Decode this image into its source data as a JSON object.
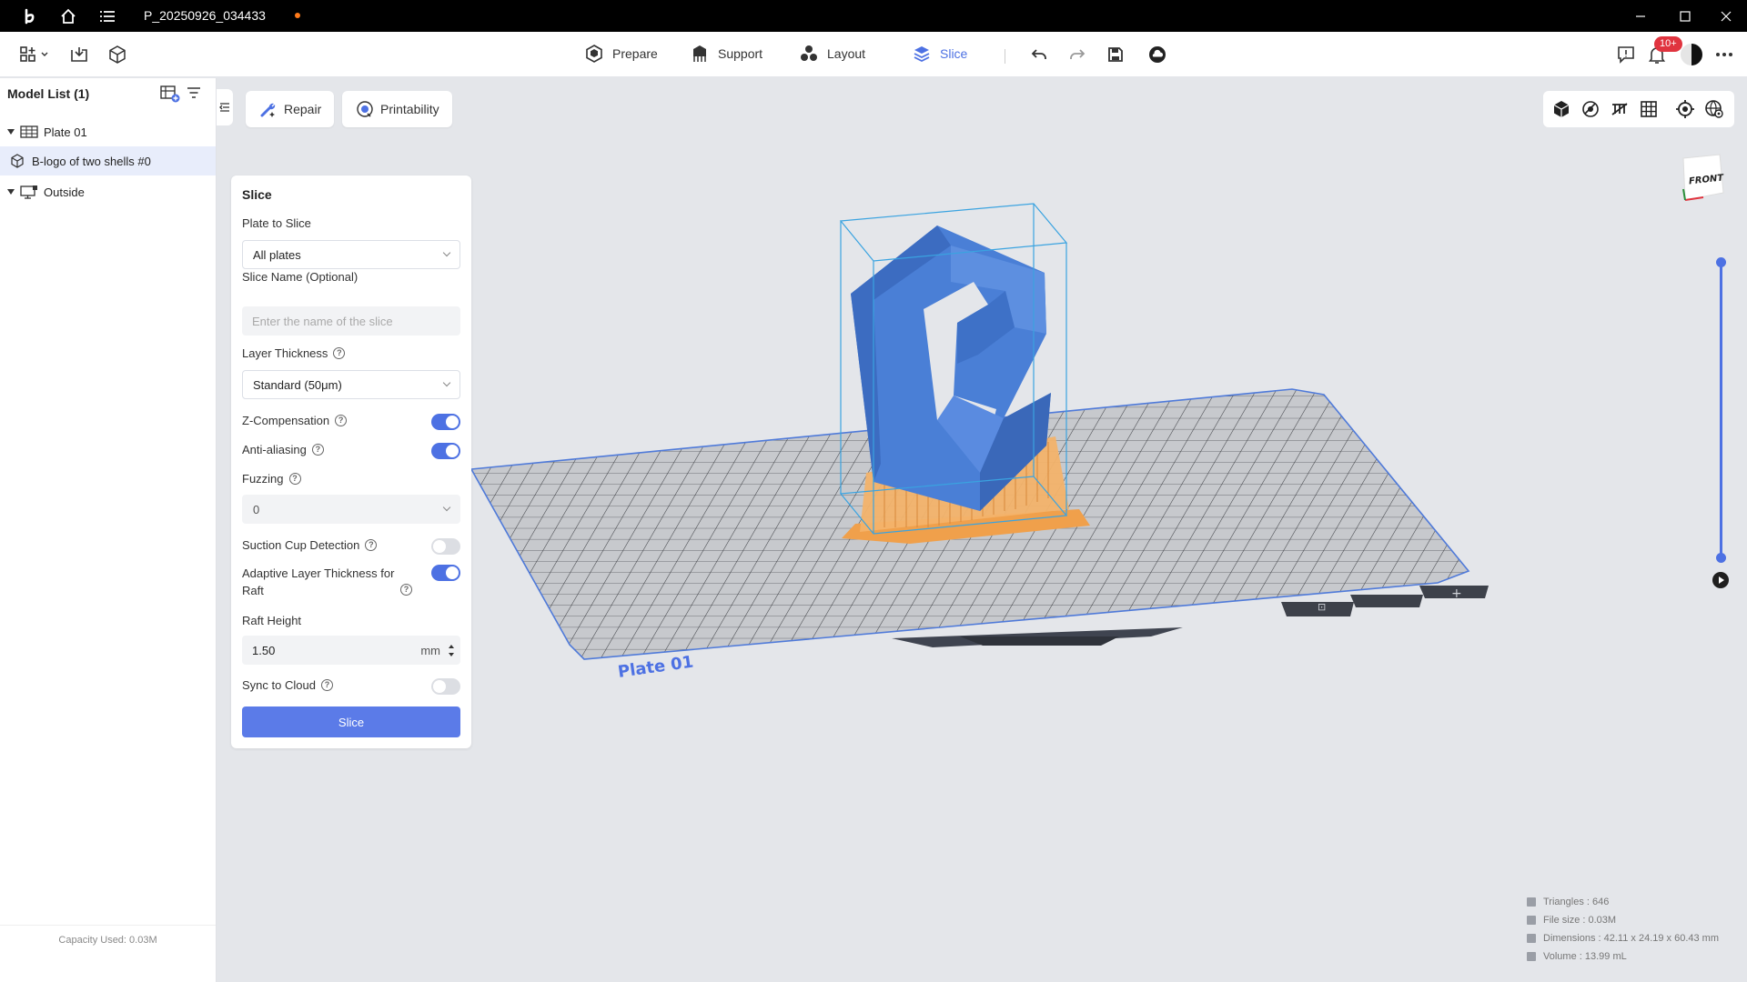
{
  "titlebar": {
    "project_name": "P_20250926_034433"
  },
  "nav": {
    "tabs": [
      {
        "label": "Prepare"
      },
      {
        "label": "Support"
      },
      {
        "label": "Layout"
      },
      {
        "label": "Slice"
      }
    ],
    "active_tab": "Slice",
    "notification_badge": "10+"
  },
  "model_list": {
    "title": "Model List (1)",
    "items": [
      {
        "label": "Plate 01"
      },
      {
        "label": "B-logo of two shells #0"
      },
      {
        "label": "Outside"
      }
    ],
    "capacity": "Capacity Used: 0.03M"
  },
  "viewport": {
    "repair_label": "Repair",
    "printability_label": "Printability",
    "plate_label": "Plate 01",
    "view_cube_label": "FRONT"
  },
  "slice_panel": {
    "title": "Slice",
    "plate_to_slice_label": "Plate to Slice",
    "plate_to_slice_value": "All plates",
    "slice_name_label": "Slice Name (Optional)",
    "slice_name_placeholder": "Enter the name of the slice",
    "slice_name_value": "",
    "layer_thickness_label": "Layer Thickness",
    "layer_thickness_value": "Standard (50μm)",
    "z_compensation_label": "Z-Compensation",
    "z_compensation_on": true,
    "anti_aliasing_label": "Anti-aliasing",
    "anti_aliasing_on": true,
    "fuzzing_label": "Fuzzing",
    "fuzzing_value": "0",
    "suction_cup_label": "Suction Cup Detection",
    "suction_cup_on": false,
    "adaptive_label": "Adaptive Layer Thickness for Raft",
    "adaptive_on": true,
    "raft_height_label": "Raft Height",
    "raft_height_value": "1.50",
    "raft_height_unit": "mm",
    "sync_label": "Sync to Cloud",
    "sync_on": false,
    "slice_button": "Slice"
  },
  "stats": {
    "triangles": "Triangles : 646",
    "file_size": "File size : 0.03M",
    "dimensions": "Dimensions : 42.11 x 24.19 x 60.43 mm",
    "volume": "Volume : 13.99 mL"
  },
  "colors": {
    "accent": "#4d71e3",
    "model": "#4a7fd6",
    "support": "#f0a04b",
    "bounding_box": "#3aa3e0"
  }
}
